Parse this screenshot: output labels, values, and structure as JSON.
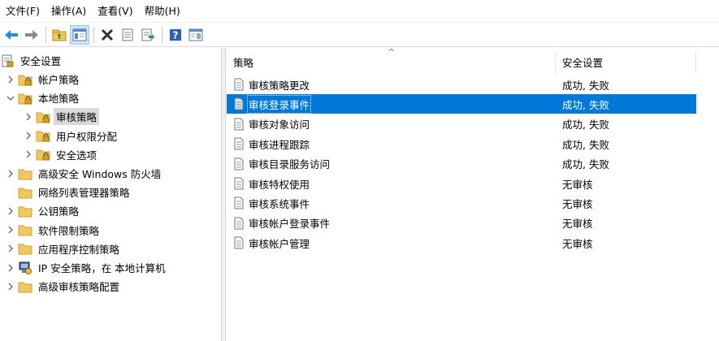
{
  "menu": [
    {
      "label": "文件(F)"
    },
    {
      "label": "操作(A)"
    },
    {
      "label": "查看(V)"
    },
    {
      "label": "帮助(H)"
    }
  ],
  "toolbar": [
    {
      "icon": "back-arrow-icon"
    },
    {
      "icon": "forward-arrow-icon"
    },
    {
      "icon": "up-folder-icon"
    },
    {
      "icon": "show-hide-tree-icon",
      "active": true
    },
    {
      "icon": "delete-icon"
    },
    {
      "icon": "properties-icon"
    },
    {
      "icon": "export-list-icon"
    },
    {
      "icon": "help-icon"
    },
    {
      "icon": "console-view-icon"
    }
  ],
  "tree": {
    "root": "安全设置",
    "items": [
      {
        "label": "帐户策略",
        "level": 1,
        "expander": "collapsed"
      },
      {
        "label": "本地策略",
        "level": 1,
        "expander": "expanded"
      },
      {
        "label": "审核策略",
        "level": 2,
        "expander": "collapsed",
        "selected": true
      },
      {
        "label": "用户权限分配",
        "level": 2,
        "expander": "collapsed"
      },
      {
        "label": "安全选项",
        "level": 2,
        "expander": "collapsed"
      },
      {
        "label": "高级安全 Windows 防火墙",
        "level": 1,
        "expander": "collapsed"
      },
      {
        "label": "网络列表管理器策略",
        "level": 1,
        "expander": "none"
      },
      {
        "label": "公钥策略",
        "level": 1,
        "expander": "collapsed"
      },
      {
        "label": "软件限制策略",
        "level": 1,
        "expander": "collapsed"
      },
      {
        "label": "应用程序控制策略",
        "level": 1,
        "expander": "collapsed"
      },
      {
        "label": "IP 安全策略，在 本地计算机",
        "level": 1,
        "expander": "collapsed",
        "icon": "ip-security-icon"
      },
      {
        "label": "高级审核策略配置",
        "level": 1,
        "expander": "collapsed"
      }
    ]
  },
  "list": {
    "columns": {
      "policy": "策略",
      "setting": "安全设置"
    },
    "rows": [
      {
        "policy": "审核策略更改",
        "setting": "成功, 失败"
      },
      {
        "policy": "审核登录事件",
        "setting": "成功, 失败",
        "selected": true
      },
      {
        "policy": "审核对象访问",
        "setting": "成功, 失败"
      },
      {
        "policy": "审核进程跟踪",
        "setting": "成功, 失败"
      },
      {
        "policy": "审核目录服务访问",
        "setting": "成功, 失败"
      },
      {
        "policy": "审核特权使用",
        "setting": "无审核"
      },
      {
        "policy": "审核系统事件",
        "setting": "无审核"
      },
      {
        "policy": "审核帐户登录事件",
        "setting": "无审核"
      },
      {
        "policy": "审核帐户管理",
        "setting": "无审核"
      }
    ]
  },
  "colors": {
    "selection": "#0078d7",
    "folder": "#f3c75f",
    "lock": "#d4a21a"
  }
}
